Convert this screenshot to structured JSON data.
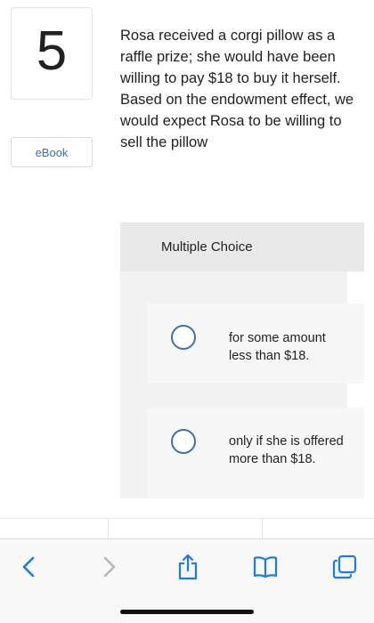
{
  "question": {
    "number": "5",
    "ebook_label": "eBook",
    "text": "Rosa received a corgi pillow as a raffle prize; she would have been willing to pay $18 to buy it herself. Based on the endowment effect, we would expect Rosa to be willing to sell the pillow"
  },
  "multiple_choice": {
    "header": "Multiple Choice",
    "options": [
      {
        "label": "for some amount less than $18.",
        "selected": false
      },
      {
        "label": "only if she is offered more than $18.",
        "selected": false
      }
    ]
  },
  "toolbar": {
    "back_icon": "chevron-left-icon",
    "forward_icon": "chevron-right-icon",
    "share_icon": "share-icon",
    "bookmarks_icon": "book-icon",
    "tabs_icon": "tabs-icon",
    "accent_color": "#1a7cf5",
    "disabled_color": "#b9b9b9"
  }
}
